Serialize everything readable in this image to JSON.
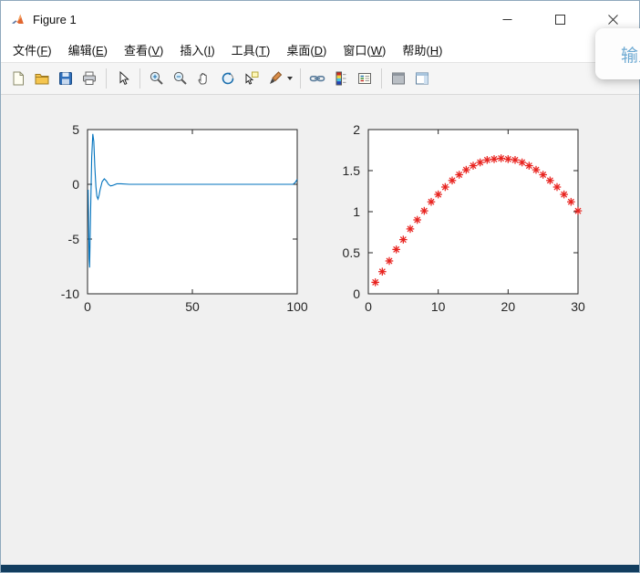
{
  "window": {
    "title": "Figure 1"
  },
  "menu_bar": {
    "items": [
      {
        "pre": "文件(",
        "key": "F",
        "post": ")"
      },
      {
        "pre": "编辑(",
        "key": "E",
        "post": ")"
      },
      {
        "pre": "查看(",
        "key": "V",
        "post": ")"
      },
      {
        "pre": "插入(",
        "key": "I",
        "post": ")"
      },
      {
        "pre": "工具(",
        "key": "T",
        "post": ")"
      },
      {
        "pre": "桌面(",
        "key": "D",
        "post": ")"
      },
      {
        "pre": "窗口(",
        "key": "W",
        "post": ")"
      },
      {
        "pre": "帮助(",
        "key": "H",
        "post": ")"
      }
    ]
  },
  "toolbar": {
    "icons": [
      "new-figure",
      "open-file",
      "save-figure",
      "print-figure",
      "edit-plot",
      "zoom-in",
      "zoom-out",
      "pan",
      "rotate-3d",
      "data-cursor",
      "brush-data",
      "link-plot",
      "insert-colorbar",
      "insert-legend",
      "hide-plot-tools",
      "show-plot-tools"
    ]
  },
  "ime_popup": {
    "text": "输入"
  },
  "chart_data": [
    {
      "type": "line",
      "color": "#0072BD",
      "xlim": [
        0,
        100
      ],
      "ylim": [
        -10,
        5
      ],
      "xticks": [
        0,
        50,
        100
      ],
      "yticks": [
        -10,
        -5,
        0,
        5
      ],
      "x": [
        0.3,
        0.8,
        1,
        1.5,
        2,
        2.5,
        3,
        3.5,
        4,
        4.5,
        5,
        5.5,
        6,
        6.5,
        7,
        8,
        9,
        10,
        11,
        12,
        14,
        16,
        20,
        30,
        40,
        50,
        60,
        70,
        80,
        90,
        95,
        98,
        99,
        100
      ],
      "y": [
        -0.5,
        -6.8,
        -7.6,
        -2,
        2.5,
        4.6,
        3.9,
        1.6,
        -0.2,
        -1.1,
        -1.35,
        -1,
        -0.5,
        -0.1,
        0.25,
        0.5,
        0.3,
        0,
        -0.15,
        -0.1,
        0.05,
        0.05,
        0,
        0,
        0,
        0,
        0,
        0,
        0,
        0,
        0,
        0,
        0.15,
        0.45
      ]
    },
    {
      "type": "scatter",
      "marker": "asterisk",
      "color": "#E8231F",
      "xlim": [
        0,
        30
      ],
      "ylim": [
        0,
        2
      ],
      "xticks": [
        0,
        10,
        20,
        30
      ],
      "yticks": [
        0,
        0.5,
        1,
        1.5,
        2
      ],
      "x": [
        1,
        2,
        3,
        4,
        5,
        6,
        7,
        8,
        9,
        10,
        11,
        12,
        13,
        14,
        15,
        16,
        17,
        18,
        19,
        20,
        21,
        22,
        23,
        24,
        25,
        26,
        27,
        28,
        29,
        30
      ],
      "y": [
        0.14,
        0.27,
        0.4,
        0.54,
        0.66,
        0.79,
        0.9,
        1.01,
        1.12,
        1.21,
        1.3,
        1.38,
        1.45,
        1.51,
        1.56,
        1.6,
        1.63,
        1.64,
        1.65,
        1.64,
        1.63,
        1.6,
        1.56,
        1.51,
        1.45,
        1.38,
        1.3,
        1.21,
        1.12,
        1.01
      ]
    }
  ]
}
